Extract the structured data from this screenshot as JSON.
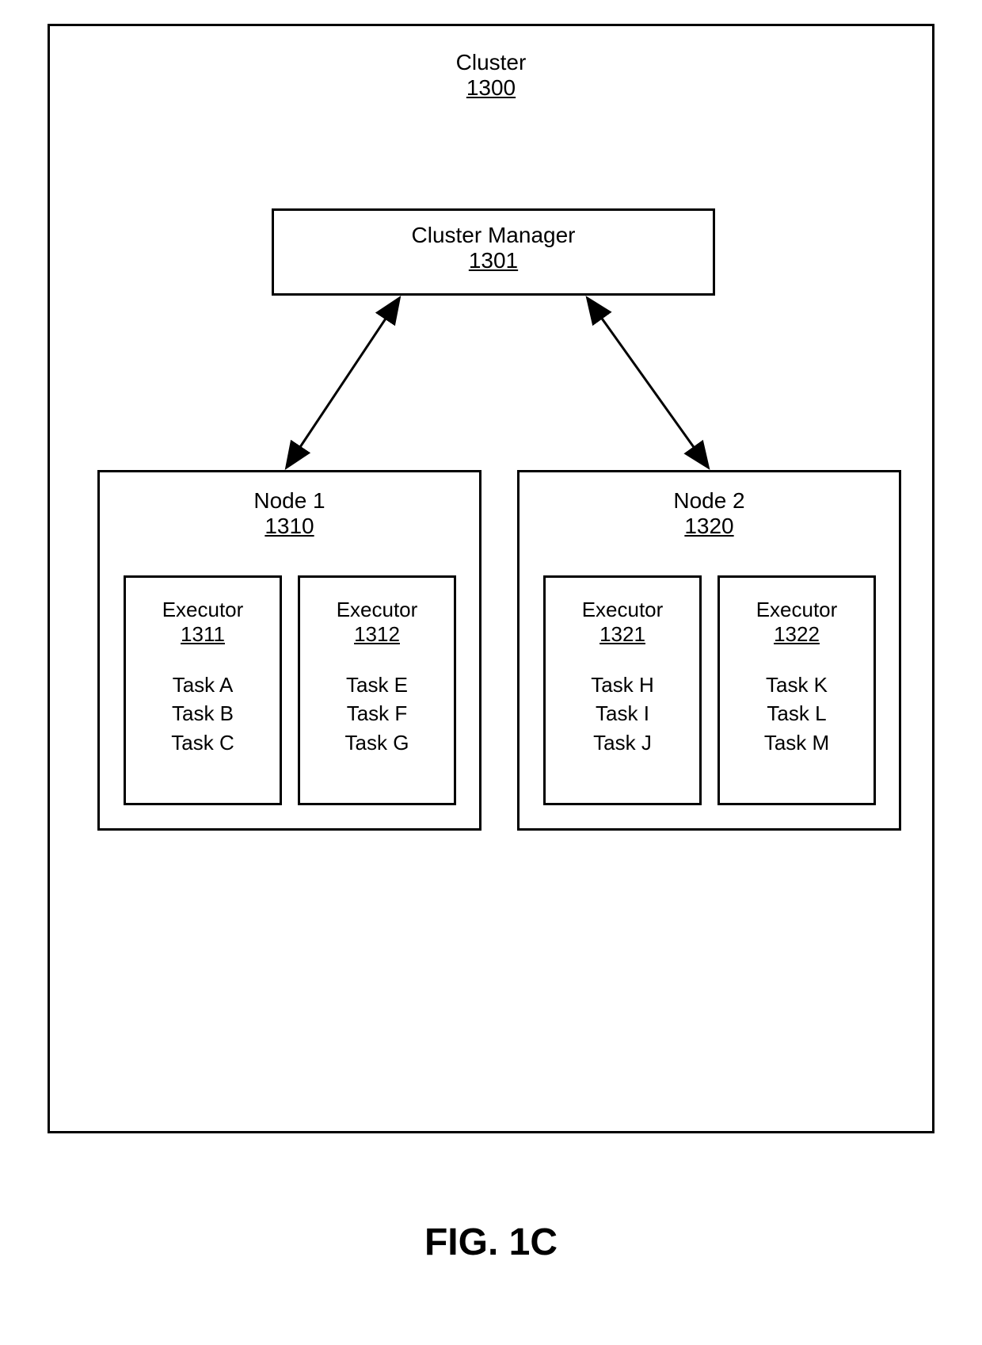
{
  "figure_label": "FIG. 1C",
  "cluster": {
    "title": "Cluster",
    "ref": "1300"
  },
  "cluster_manager": {
    "title": "Cluster Manager",
    "ref": "1301"
  },
  "nodes": [
    {
      "title": "Node 1",
      "ref": "1310",
      "executors": [
        {
          "title": "Executor",
          "ref": "1311",
          "tasks": [
            "Task A",
            "Task B",
            "Task C"
          ]
        },
        {
          "title": "Executor",
          "ref": "1312",
          "tasks": [
            "Task E",
            "Task F",
            "Task G"
          ]
        }
      ]
    },
    {
      "title": "Node 2",
      "ref": "1320",
      "executors": [
        {
          "title": "Executor",
          "ref": "1321",
          "tasks": [
            "Task H",
            "Task I",
            "Task J"
          ]
        },
        {
          "title": "Executor",
          "ref": "1322",
          "tasks": [
            "Task K",
            "Task L",
            "Task M"
          ]
        }
      ]
    }
  ]
}
